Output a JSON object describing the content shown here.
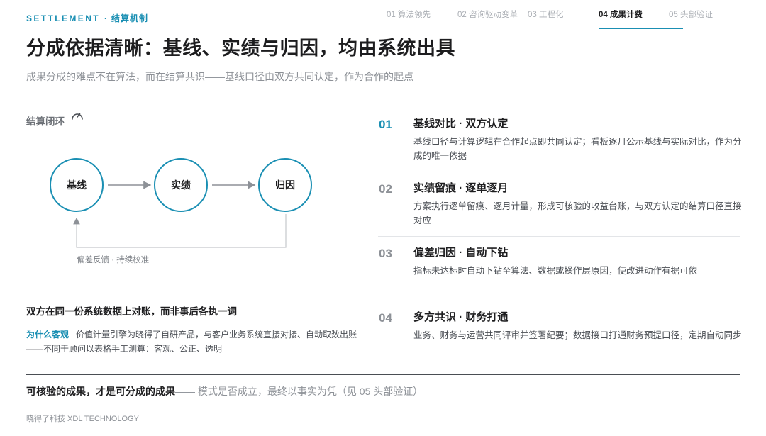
{
  "header": {
    "kicker_en": "SETTLEMENT",
    "kicker_sep": "·",
    "kicker_cn": "结算机制",
    "title": "分成依据清晰：基线、实绩与归因，均由系统出具",
    "subtitle": "成果分成的难点不在算法，而在结算共识——基线口径由双方共同认定，作为合作的起点"
  },
  "nav": {
    "tabs": [
      {
        "label": "01 算法领先",
        "active": false
      },
      {
        "label": "02 咨询驱动变革",
        "active": false
      },
      {
        "label": "03 工程化",
        "active": false
      },
      {
        "label": "04 成果计费",
        "active": true
      },
      {
        "label": "05 头部验证",
        "active": false
      }
    ]
  },
  "loop": {
    "label": "结算闭环",
    "icon": "gauge-icon",
    "nodes": [
      "基线",
      "实绩",
      "归因"
    ],
    "feedback": "偏差反馈 · 持续校准",
    "accent_color": "#1a8fb3"
  },
  "left": {
    "headline": "双方在同一份系统数据上对账，而非事后各执一词",
    "why_label": "为什么客观",
    "why_text": "价值计量引擎为晓得了自研产品，与客户业务系统直接对接、自动取数出账——不同于顾问以表格手工测算：客观、公正、透明"
  },
  "steps": [
    {
      "num": "01",
      "title": "基线对比 · 双方认定",
      "desc": "基线口径与计算逻辑在合作起点即共同认定；看板逐月公示基线与实际对比，作为分成的唯一依据"
    },
    {
      "num": "02",
      "title": "实绩留痕 · 逐单逐月",
      "desc": "方案执行逐单留痕、逐月计量，形成可核验的收益台账，与双方认定的结算口径直接对应"
    },
    {
      "num": "03",
      "title": "偏差归因 · 自动下钻",
      "desc": "指标未达标时自动下钻至算法、数据或操作层原因，使改进动作有据可依"
    },
    {
      "num": "04",
      "title": "多方共识 · 财务打通",
      "desc": "业务、财务与运营共同评审并签署纪要；数据接口打通财务预提口径，定期自动同步"
    }
  ],
  "conclusion": {
    "strong": "可核验的成果，才是可分成的成果",
    "rest": "—— 模式是否成立，最终以事实为凭（见 05 头部验证）"
  },
  "footer": "晓得了科技 XDL TECHNOLOGY"
}
